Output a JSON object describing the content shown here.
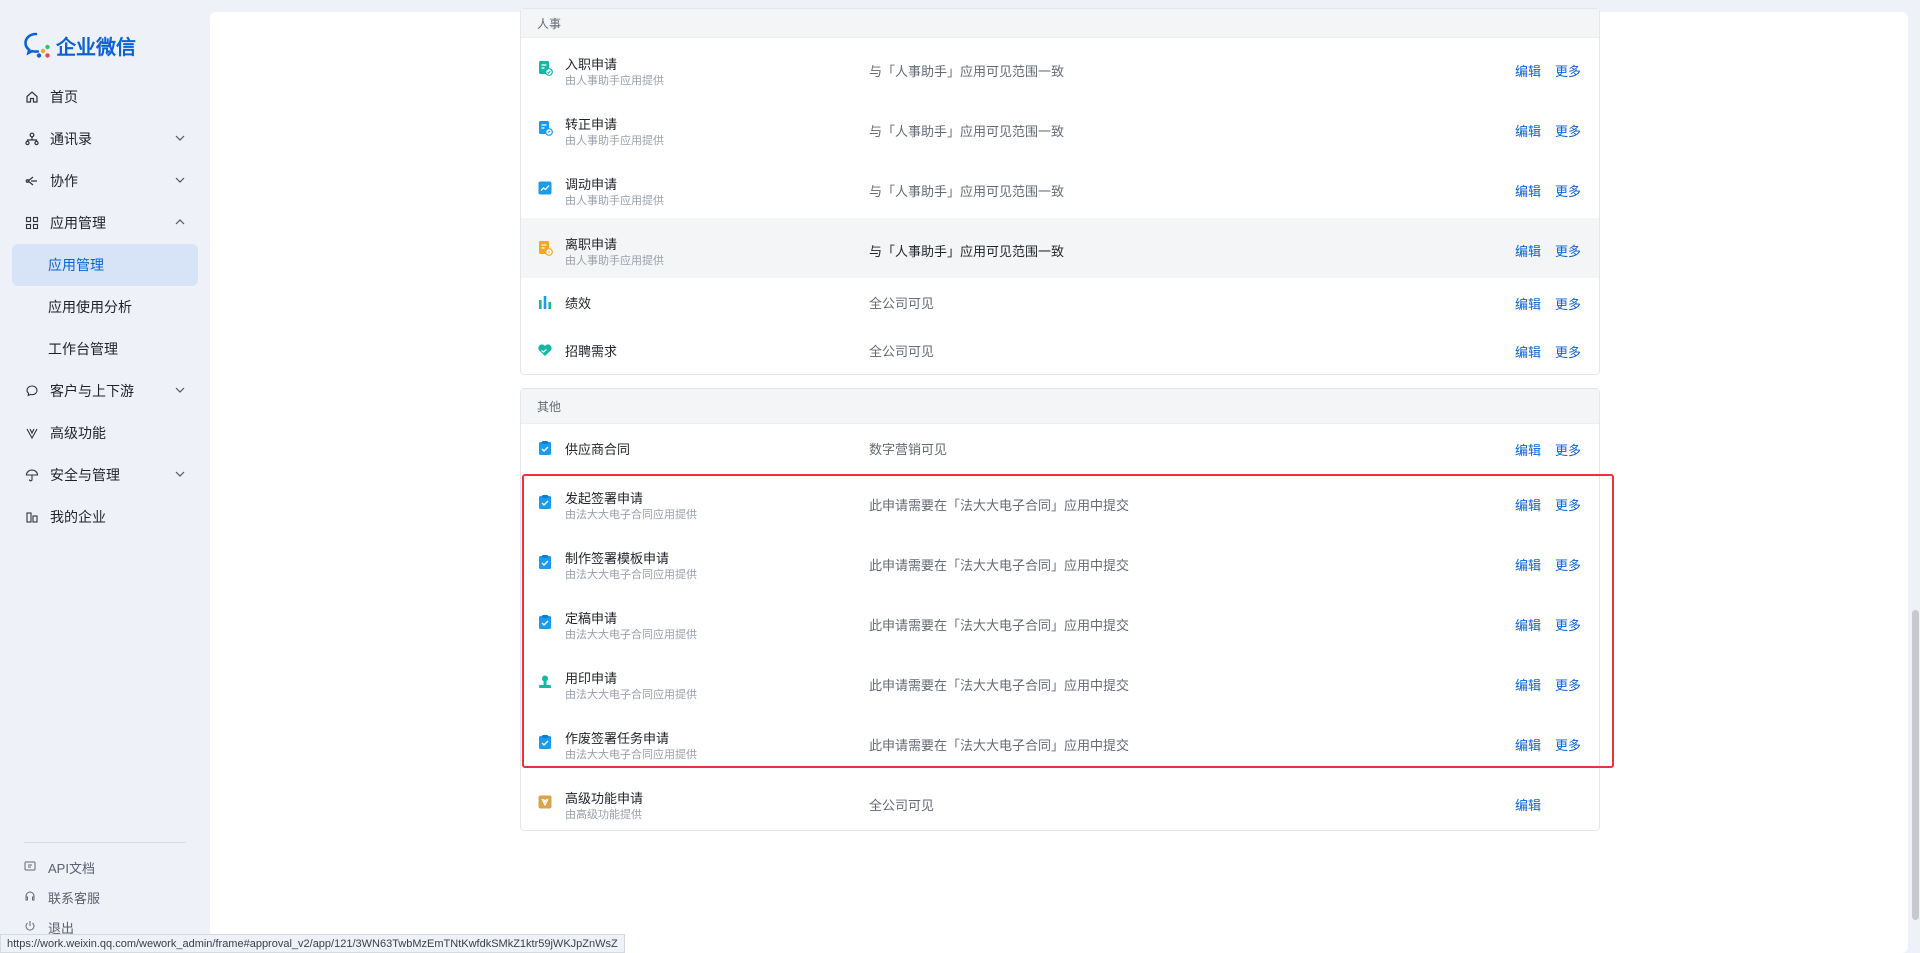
{
  "app": {
    "logo_text": "企业微信",
    "brand_color": "#0b62d6"
  },
  "sidebar": {
    "items": [
      {
        "label": "首页",
        "icon": "home-icon"
      },
      {
        "label": "通讯录",
        "icon": "org-icon",
        "expandable": true
      },
      {
        "label": "协作",
        "icon": "collab-icon",
        "expandable": true
      },
      {
        "label": "应用管理",
        "icon": "apps-icon",
        "expandable": true,
        "expanded": true
      },
      {
        "label": "应用管理",
        "sub": true,
        "active": true
      },
      {
        "label": "应用使用分析",
        "sub": true
      },
      {
        "label": "工作台管理",
        "sub": true
      },
      {
        "label": "客户与上下游",
        "icon": "chat-icon",
        "expandable": true
      },
      {
        "label": "高级功能",
        "icon": "advanced-icon"
      },
      {
        "label": "安全与管理",
        "icon": "umbrella-icon",
        "expandable": true
      },
      {
        "label": "我的企业",
        "icon": "company-icon"
      }
    ],
    "bottom": [
      {
        "label": "API文档",
        "icon": "api-icon"
      },
      {
        "label": "联系客服",
        "icon": "headset-icon"
      },
      {
        "label": "退出",
        "icon": "logout-icon"
      }
    ]
  },
  "sections": {
    "hr": {
      "title": "人事",
      "rows": [
        {
          "name": "入职申请",
          "provider": "由人事助手应用提供",
          "scope": "与「人事助手」应用可见范围一致",
          "icon": "onboard-doc-icon",
          "edit": "编辑",
          "more": "更多"
        },
        {
          "name": "转正申请",
          "provider": "由人事助手应用提供",
          "scope": "与「人事助手」应用可见范围一致",
          "icon": "regular-doc-icon",
          "edit": "编辑",
          "more": "更多"
        },
        {
          "name": "调动申请",
          "provider": "由人事助手应用提供",
          "scope": "与「人事助手」应用可见范围一致",
          "icon": "transfer-chart-icon",
          "edit": "编辑",
          "more": "更多"
        },
        {
          "name": "离职申请",
          "provider": "由人事助手应用提供",
          "scope": "与「人事助手」应用可见范围一致",
          "icon": "resign-doc-icon",
          "edit": "编辑",
          "more": "更多"
        },
        {
          "name": "绩效",
          "scope": "全公司可见",
          "icon": "bar-chart-icon",
          "edit": "编辑",
          "more": "更多"
        },
        {
          "name": "招聘需求",
          "scope": "全公司可见",
          "icon": "handshake-heart-icon",
          "edit": "编辑",
          "more": "更多"
        }
      ]
    },
    "other": {
      "title": "其他",
      "rows": [
        {
          "name": "供应商合同",
          "scope": "数字营销可见",
          "icon": "clipboard-check-icon",
          "edit": "编辑",
          "more": "更多"
        },
        {
          "name": "发起签署申请",
          "provider": "由法大大电子合同应用提供",
          "scope": "此申请需要在「法大大电子合同」应用中提交",
          "icon": "clipboard-check-icon",
          "edit": "编辑",
          "more": "更多"
        },
        {
          "name": "制作签署模板申请",
          "provider": "由法大大电子合同应用提供",
          "scope": "此申请需要在「法大大电子合同」应用中提交",
          "icon": "clipboard-check-icon",
          "edit": "编辑",
          "more": "更多"
        },
        {
          "name": "定稿申请",
          "provider": "由法大大电子合同应用提供",
          "scope": "此申请需要在「法大大电子合同」应用中提交",
          "icon": "clipboard-check-icon",
          "edit": "编辑",
          "more": "更多"
        },
        {
          "name": "用印申请",
          "provider": "由法大大电子合同应用提供",
          "scope": "此申请需要在「法大大电子合同」应用中提交",
          "icon": "stamp-icon",
          "edit": "编辑",
          "more": "更多"
        },
        {
          "name": "作废签署任务申请",
          "provider": "由法大大电子合同应用提供",
          "scope": "此申请需要在「法大大电子合同」应用中提交",
          "icon": "clipboard-check-icon",
          "edit": "编辑",
          "more": "更多"
        },
        {
          "name": "高级功能申请",
          "provider": "由高级功能提供",
          "scope": "全公司可见",
          "icon": "advanced-app-icon",
          "edit": "编辑"
        }
      ]
    }
  },
  "status_bar": {
    "url": "https://work.weixin.qq.com/wework_admin/frame#approval_v2/app/121/3WN63TwbMzEmTNtKwfdkSMkZ1ktr59jWKJpZnWsZ"
  },
  "colors": {
    "highlight_box": "#f0303a",
    "link": "#0b62d6",
    "icon_teal": "#14b8a6",
    "icon_blue": "#1a9bf0",
    "icon_orange": "#f5a623",
    "icon_gold": "#d9a54a"
  }
}
